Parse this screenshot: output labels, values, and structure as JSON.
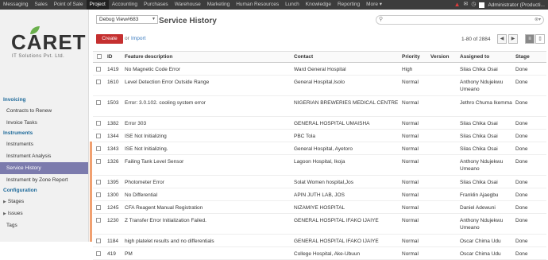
{
  "topbar": {
    "menu": [
      "Messaging",
      "Sales",
      "Point of Sale",
      "Project",
      "Accounting",
      "Purchases",
      "Warehouse",
      "Marketing",
      "Human Resources",
      "Lunch",
      "Knowledge",
      "Reporting",
      "More ▾"
    ],
    "active_index": 3,
    "user": "Administrator (Producti..."
  },
  "sidebar": {
    "logo_text": "CARET",
    "logo_sub": "IT Solutions Pvt. Ltd.",
    "sections": [
      {
        "type": "section",
        "label": "Invoicing"
      },
      {
        "type": "item",
        "label": "Contracts to Renew"
      },
      {
        "type": "item",
        "label": "Invoice Tasks"
      },
      {
        "type": "section",
        "label": "Instruments"
      },
      {
        "type": "item",
        "label": "Instruments"
      },
      {
        "type": "item",
        "label": "Instrument Analysis"
      },
      {
        "type": "item",
        "label": "Service History",
        "selected": true
      },
      {
        "type": "item",
        "label": "Instrument by Zone Report"
      },
      {
        "type": "section",
        "label": "Configuration"
      },
      {
        "type": "tri",
        "label": "Stages"
      },
      {
        "type": "tri",
        "label": "Issues"
      },
      {
        "type": "item",
        "label": "Tags"
      }
    ]
  },
  "main": {
    "debug_select": "Debug View#683",
    "title": "Service History",
    "create_label": "Create",
    "or_label": "or",
    "import_label": "Import",
    "pager": "1-80 of 2884",
    "columns": [
      "ID",
      "Feature description",
      "Contact",
      "Priority",
      "Version",
      "Assigned to",
      "Stage"
    ],
    "rows": [
      {
        "id": "1419",
        "desc": "No Magnetic Code Error",
        "contact": "Ward General Hospital",
        "priority": "High",
        "version": "",
        "assigned": "Silas Chika Osai",
        "stage": "Done",
        "h": 1
      },
      {
        "id": "1610",
        "desc": "Level Detection Error Outside Range",
        "contact": "General Hospital,Isolo",
        "priority": "Normal",
        "version": "",
        "assigned": "Anthony Ndujekwu Umeano",
        "stage": "Done",
        "h": 2
      },
      {
        "id": "1503",
        "desc": "Error: 3.0.102. cooling system error",
        "contact": "NIGERIAN BREWERIES MEDICAL CENTRE",
        "priority": "Normal",
        "version": "",
        "assigned": "Jethro Chuma Ikemma",
        "stage": "Done",
        "h": 2
      },
      {
        "id": "1382",
        "desc": "Error 303",
        "contact": "GENERAL HOSPITAL UMAISHA",
        "priority": "Normal",
        "version": "",
        "assigned": "Silas Chika Osai",
        "stage": "Done",
        "h": 1
      },
      {
        "id": "1344",
        "desc": "ISE Not Initializing",
        "contact": "PBC Tola",
        "priority": "Normal",
        "version": "",
        "assigned": "Silas Chika Osai",
        "stage": "Done",
        "h": 1
      },
      {
        "id": "1343",
        "desc": "ISE Not Initializing.",
        "contact": "General Hospital, Ayetoro",
        "priority": "Normal",
        "version": "",
        "assigned": "Silas Chika Osai",
        "stage": "Done",
        "h": 1
      },
      {
        "id": "1326",
        "desc": "Failing Tank Level Sensor",
        "contact": "Lagoon Hospital, Ikoja",
        "priority": "Normal",
        "version": "",
        "assigned": "Anthony Ndujekwu Umeano",
        "stage": "Done",
        "h": 2
      },
      {
        "id": "1395",
        "desc": "Photometer Error",
        "contact": "Solat Women hospital,Jos",
        "priority": "Normal",
        "version": "",
        "assigned": "Silas Chika Osai",
        "stage": "Done",
        "h": 1
      },
      {
        "id": "1300",
        "desc": "No Differential",
        "contact": "APIN JUTH LAB, JOS",
        "priority": "Normal",
        "version": "",
        "assigned": "Franklin Ajaegbu",
        "stage": "Done",
        "h": 1
      },
      {
        "id": "1245",
        "desc": "CFA Reagent Manual Registration",
        "contact": "NIZAMIYE HOSPITAL",
        "priority": "Normal",
        "version": "",
        "assigned": "Daniel Adewuni",
        "stage": "Done",
        "h": 1
      },
      {
        "id": "1230",
        "desc": "Z Transfer Error Initialization Failed.",
        "contact": "GENERAL HOSPITAL IFAKO IJAIYE",
        "priority": "Normal",
        "version": "",
        "assigned": "Anthony Ndujekwu Umeano",
        "stage": "Done",
        "h": 2
      },
      {
        "id": "1184",
        "desc": "high platelet results and no differentials",
        "contact": "GENERAL HOSPITAL IFAKO IJAIYE",
        "priority": "Normal",
        "version": "",
        "assigned": "Oscar Chima Udu",
        "stage": "Done",
        "h": 1
      },
      {
        "id": "419",
        "desc": "PM",
        "contact": "College Hospital, Ake-Ubuun",
        "priority": "Normal",
        "version": "",
        "assigned": "Oscar Chima Udu",
        "stage": "Done",
        "h": 1
      }
    ]
  },
  "colors": {
    "topbar": "#3c3c3c",
    "create": "#c53030",
    "selected": "#7c7bad",
    "section": "#1e6a9a",
    "link": "#3a7bbf"
  }
}
